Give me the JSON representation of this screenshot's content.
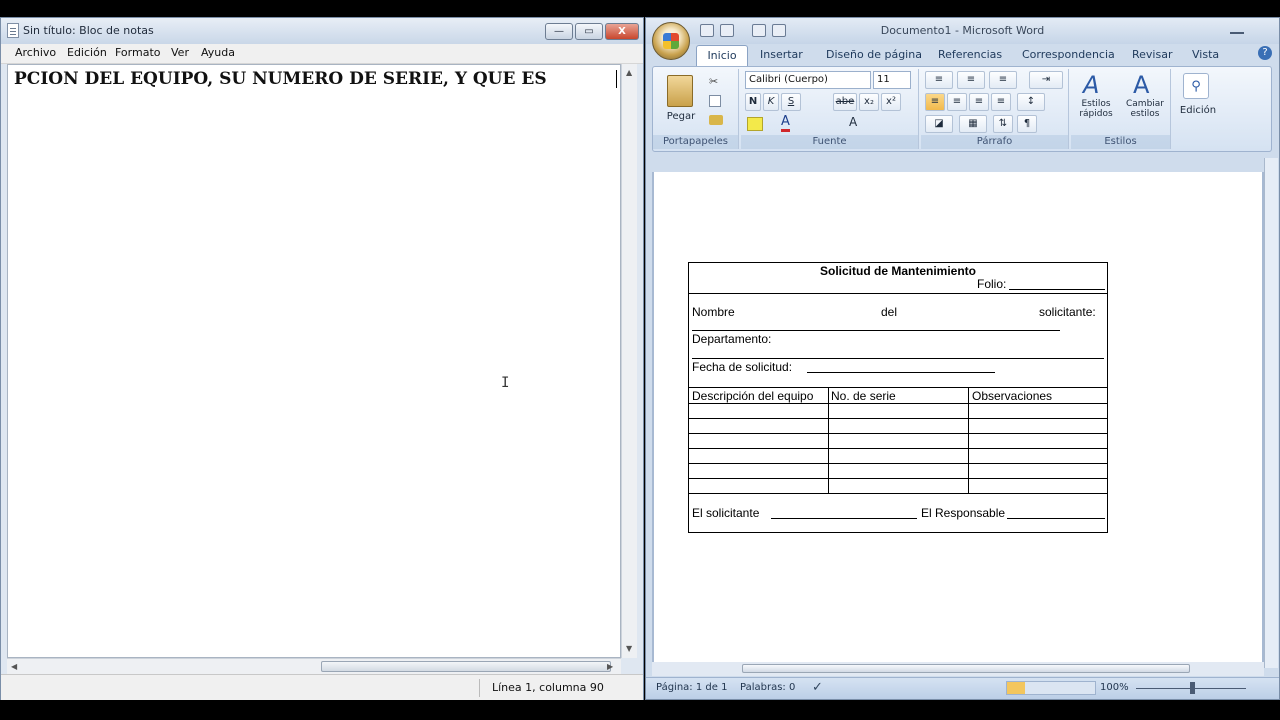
{
  "notepad": {
    "title": "Sin título: Bloc de notas",
    "menu": [
      "Archivo",
      "Edición",
      "Formato",
      "Ver",
      "Ayuda"
    ],
    "text": "PCION DEL EQUIPO, SU NUMERO DE SERIE, Y QUE ES",
    "status": "Línea 1, columna 90",
    "caption_buttons": [
      "—",
      "▭",
      "X"
    ]
  },
  "word": {
    "title": "Documento1 - Microsoft Word",
    "tabs": [
      "Inicio",
      "Insertar",
      "Diseño de página",
      "Referencias",
      "Correspondencia",
      "Revisar",
      "Vista"
    ],
    "help_icon": "?",
    "clipboard": {
      "paste_label": "Pegar",
      "group": "Portapapeles"
    },
    "font": {
      "name": "Calibri (Cuerpo)",
      "size": "11",
      "group": "Fuente",
      "buttons": [
        "N",
        "K",
        "S",
        "abe",
        "x₂",
        "x²"
      ]
    },
    "paragraph": {
      "group": "Párrafo"
    },
    "styles": {
      "quick": "Estilos rápidos",
      "change": "Cambiar estilos",
      "group": "Estilos"
    },
    "editing": {
      "label": "Edición"
    },
    "status": {
      "page": "Página: 1 de 1",
      "words": "Palabras: 0",
      "zoom": "100%"
    },
    "form": {
      "title": "Solicitud de Mantenimiento",
      "folio": "Folio:",
      "nombre_parts": [
        "Nombre",
        "del",
        "solicitante:"
      ],
      "departamento": "Departamento:",
      "fecha": "Fecha de solicitud:",
      "columns": [
        "Descripción del equipo",
        "No. de serie",
        "Observaciones"
      ],
      "solicitante": "El solicitante",
      "responsable": "El Responsable"
    }
  }
}
